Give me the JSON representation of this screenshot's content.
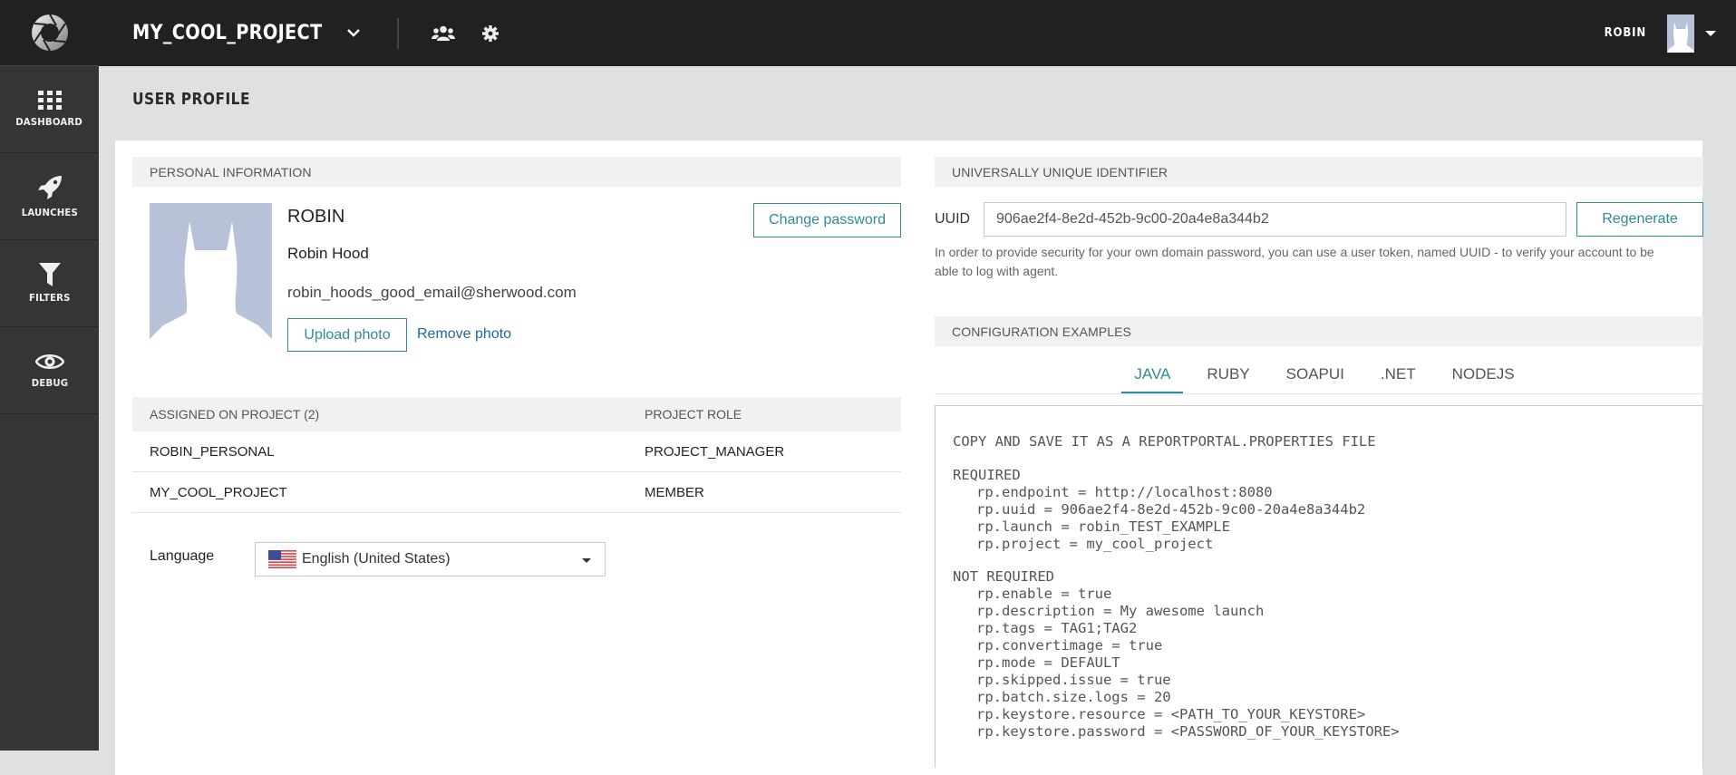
{
  "sidebar": {
    "logo": "aperture-logo",
    "items": [
      {
        "label": "DASHBOARD",
        "icon": "grid-icon"
      },
      {
        "label": "LAUNCHES",
        "icon": "rocket-icon"
      },
      {
        "label": "FILTERS",
        "icon": "filter-icon"
      },
      {
        "label": "DEBUG",
        "icon": "eye-icon"
      }
    ]
  },
  "topbar": {
    "project_name": "MY_COOL_PROJECT",
    "project_dropdown_icon": "chevron-down-icon",
    "members_icon": "users-icon",
    "settings_icon": "gear-icon",
    "user_name": "ROBIN",
    "user_avatar_icon": "avatar-icon",
    "user_menu_icon": "caret-down-icon"
  },
  "page": {
    "title": "USER PROFILE"
  },
  "personal_info": {
    "header": "PERSONAL INFORMATION",
    "login": "ROBIN",
    "full_name": "Robin Hood",
    "email": "robin_hoods_good_email@sherwood.com",
    "upload_photo_label": "Upload photo",
    "remove_photo_label": "Remove photo",
    "change_password_label": "Change password"
  },
  "projects": {
    "header_project": "ASSIGNED ON PROJECT (2)",
    "header_role": "PROJECT ROLE",
    "rows": [
      {
        "project": "ROBIN_PERSONAL",
        "role": "PROJECT_MANAGER"
      },
      {
        "project": "MY_COOL_PROJECT",
        "role": "MEMBER"
      }
    ]
  },
  "language": {
    "label": "Language",
    "selected": "English (United States)",
    "flag_icon": "us-flag-icon"
  },
  "uuid": {
    "header": "UNIVERSALLY UNIQUE IDENTIFIER",
    "label": "UUID",
    "value": "906ae2f4-8e2d-452b-9c00-20a4e8a344b2",
    "regenerate_label": "Regenerate",
    "help_text": "In order to provide security for your own domain password, you can use a user token, named UUID - to verify your account to be able to log with agent."
  },
  "config": {
    "header": "CONFIGURATION EXAMPLES",
    "tabs": [
      {
        "label": "JAVA",
        "active": true
      },
      {
        "label": "RUBY",
        "active": false
      },
      {
        "label": "SOAPUI",
        "active": false
      },
      {
        "label": ".NET",
        "active": false
      },
      {
        "label": "NODEJS",
        "active": false
      }
    ],
    "code": {
      "title": "COPY AND SAVE IT AS A REPORTPORTAL.PROPERTIES FILE",
      "required_header": "REQUIRED",
      "required": [
        "rp.endpoint = http://localhost:8080",
        "rp.uuid = 906ae2f4-8e2d-452b-9c00-20a4e8a344b2",
        "rp.launch = robin_TEST_EXAMPLE",
        "rp.project = my_cool_project"
      ],
      "not_required_header": "NOT REQUIRED",
      "not_required": [
        "rp.enable = true",
        "rp.description = My awesome launch",
        "rp.tags = TAG1;TAG2",
        "rp.convertimage = true",
        "rp.mode = DEFAULT",
        "rp.skipped.issue = true",
        "rp.batch.size.logs = 20",
        "rp.keystore.resource = <PATH_TO_YOUR_KEYSTORE>",
        "rp.keystore.password = <PASSWORD_OF_YOUR_KEYSTORE>"
      ]
    }
  },
  "colors": {
    "accent": "#2f8b99",
    "link": "#2366a8",
    "topbar_bg": "#212121",
    "sidebar_bg": "#353535",
    "page_bg": "#dfe0e2",
    "section_header_bg": "#f1f1f1",
    "avatar_bg": "#b7c1d8"
  }
}
